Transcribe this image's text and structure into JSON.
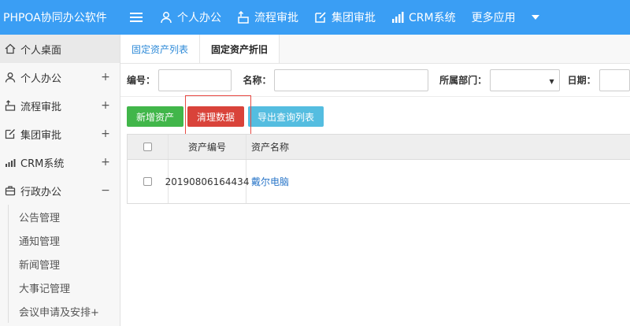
{
  "app": {
    "title": "PHPOA协同办公软件"
  },
  "nav": {
    "items": [
      {
        "label": "个人办公",
        "icon": "user-icon"
      },
      {
        "label": "流程审批",
        "icon": "workflow-icon"
      },
      {
        "label": "集团审批",
        "icon": "edit-icon"
      },
      {
        "label": "CRM系统",
        "icon": "bar-chart-icon"
      }
    ],
    "more_label": "更多应用"
  },
  "sidebar": {
    "items": [
      {
        "label": "个人桌面",
        "icon": "home-icon",
        "toggle": ""
      },
      {
        "label": "个人办公",
        "icon": "user-icon",
        "toggle": "+"
      },
      {
        "label": "流程审批",
        "icon": "workflow-icon",
        "toggle": "+"
      },
      {
        "label": "集团审批",
        "icon": "edit-icon",
        "toggle": "+"
      },
      {
        "label": "CRM系统",
        "icon": "bar-chart-icon",
        "toggle": "+"
      },
      {
        "label": "行政办公",
        "icon": "briefcase-icon",
        "toggle": "−"
      }
    ],
    "sub_items": [
      {
        "label": "公告管理"
      },
      {
        "label": "通知管理"
      },
      {
        "label": "新闻管理"
      },
      {
        "label": "大事记管理"
      },
      {
        "label": "会议申请及安排+"
      }
    ]
  },
  "tabs": [
    {
      "label": "固定资产列表"
    },
    {
      "label": "固定资产折旧"
    }
  ],
  "filters": {
    "number_label": "编号：",
    "name_label": "名称：",
    "dept_label": "所属部门：",
    "date_label": "日期："
  },
  "actions": {
    "add_label": "新增资产",
    "clear_label": "清理数据",
    "export_label": "导出查询列表"
  },
  "table": {
    "headers": [
      "资产编号",
      "资产名称"
    ],
    "rows": [
      {
        "number": "20190806164434",
        "name": "戴尔电脑"
      }
    ]
  },
  "colors": {
    "topbar": "#3a9ef4",
    "green": "#41b64a",
    "red": "#d9433a",
    "cyan": "#54bde0",
    "link": "#2b77c9"
  }
}
